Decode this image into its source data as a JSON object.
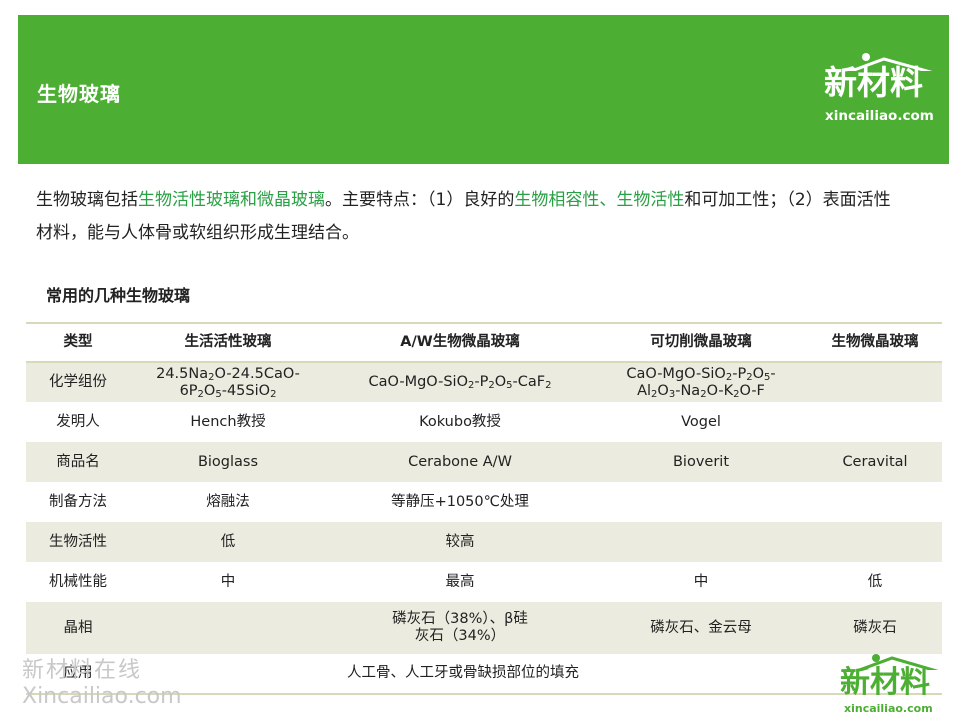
{
  "header": {
    "title": "生物玻璃",
    "logo_cn": "新材料",
    "logo_en": "xincailiao.com"
  },
  "intro": {
    "p1": "生物玻璃包括",
    "h1": "生物活性玻璃和微晶玻璃",
    "p2": "。主要特点：（1）良好的",
    "h2": "生物相容性、生物活性",
    "p3": "和可加工性；（2）表面活性材料，能与人体骨或软组织形成生理结合。"
  },
  "table": {
    "title": "常用的几种生物玻璃",
    "headers": [
      "类型",
      "生活活性玻璃",
      "A/W生物微晶玻璃",
      "可切削微晶玻璃",
      "生物微晶玻璃"
    ],
    "rows": {
      "inventor": [
        "发明人",
        "Hench教授",
        "Kokubo教授",
        "Vogel",
        ""
      ],
      "trade": [
        "商品名",
        "Bioglass",
        "Cerabone A/W",
        "Bioverit",
        "Ceravital"
      ],
      "method": [
        "制备方法",
        "熔融法",
        "等静压+1050℃处理"
      ],
      "activity": [
        "生物活性",
        "低",
        "较高"
      ],
      "mechanical": [
        "机械性能",
        "中",
        "最高",
        "中",
        "低"
      ],
      "phase": [
        "晶相",
        "",
        "磷灰石（38%）、β硅灰石（34%）",
        "磷灰石、金云母",
        "磷灰石"
      ],
      "application": [
        "应用",
        "人工骨、人工牙或骨缺损部位的填充"
      ]
    },
    "composition_label": "化学组份"
  },
  "watermark": {
    "cn": "新材料在线",
    "en": "Xincailiao.com"
  },
  "footer_logo": {
    "cn": "新材料",
    "en": "xincailiao.com"
  },
  "colors": {
    "header_bg": "#4cae33",
    "highlight": "#2aa045",
    "row_shade": "#ebebdf"
  }
}
